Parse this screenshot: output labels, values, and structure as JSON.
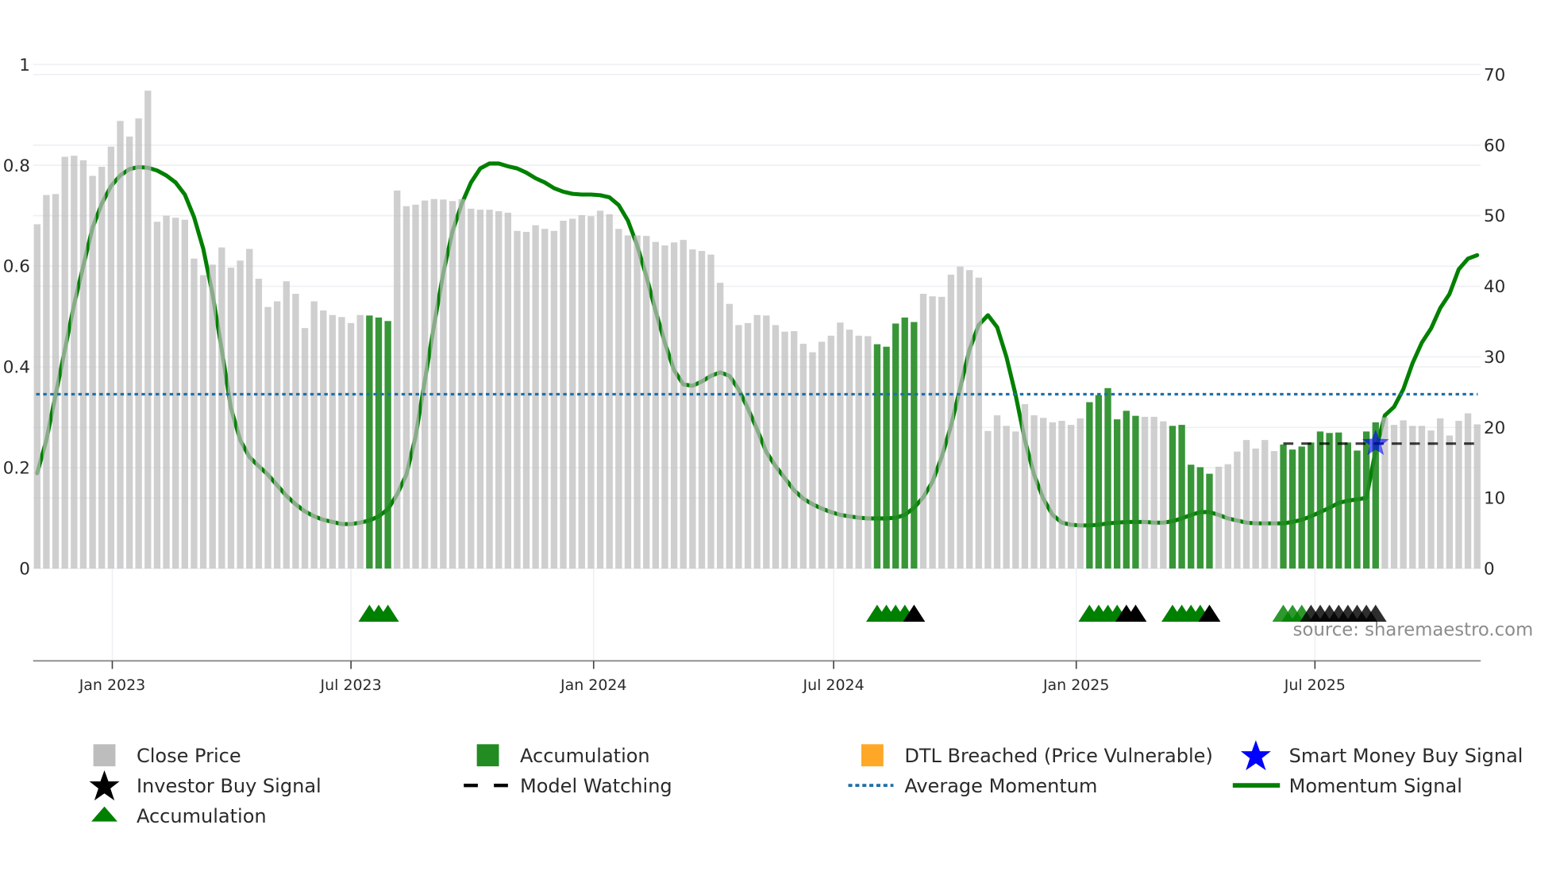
{
  "chart_data": {
    "type": "bar",
    "title": "",
    "xlabel": "",
    "ylabel": "",
    "x_start": "2022-11-05",
    "x_freq": "weekly",
    "left_axis": {
      "ylim": [
        0,
        1
      ],
      "ticks": [
        "0",
        "0.2",
        "0.4",
        "0.6",
        "0.8",
        "1"
      ],
      "tick_values": [
        0,
        0.2,
        0.4,
        0.6,
        0.8,
        1
      ]
    },
    "right_axis": {
      "ylim": [
        0,
        70
      ],
      "ticks": [
        "0",
        "10",
        "20",
        "30",
        "40",
        "50",
        "60",
        "70"
      ],
      "tick_values": [
        0,
        10,
        20,
        30,
        40,
        50,
        60,
        70
      ]
    },
    "x_ticks": [
      {
        "label": "Jan 2023",
        "date": "2023-01-01"
      },
      {
        "label": "Jul 2023",
        "date": "2023-07-01"
      },
      {
        "label": "Jan 2024",
        "date": "2024-01-01"
      },
      {
        "label": "Jul 2024",
        "date": "2024-07-01"
      },
      {
        "label": "Jan 2025",
        "date": "2025-01-01"
      },
      {
        "label": "Jul 2025",
        "date": "2025-07-01"
      }
    ],
    "grid": true,
    "close_price": [
      0.683,
      0.741,
      0.743,
      0.817,
      0.819,
      0.81,
      0.779,
      0.797,
      0.837,
      0.888,
      0.857,
      0.893,
      0.948,
      0.688,
      0.7,
      0.696,
      0.692,
      0.615,
      0.582,
      0.603,
      0.637,
      0.597,
      0.611,
      0.634,
      0.575,
      0.519,
      0.53,
      0.57,
      0.545,
      0.477,
      0.53,
      0.512,
      0.503,
      0.499,
      0.487,
      0.503,
      0.502,
      0.498,
      0.491,
      0.75,
      0.719,
      0.722,
      0.73,
      0.733,
      0.732,
      0.729,
      0.733,
      0.714,
      0.712,
      0.712,
      0.709,
      0.706,
      0.67,
      0.668,
      0.681,
      0.674,
      0.67,
      0.69,
      0.694,
      0.701,
      0.699,
      0.71,
      0.703,
      0.674,
      0.661,
      0.661,
      0.66,
      0.648,
      0.641,
      0.647,
      0.652,
      0.633,
      0.63,
      0.623,
      0.567,
      0.525,
      0.483,
      0.487,
      0.503,
      0.502,
      0.483,
      0.47,
      0.471,
      0.446,
      0.429,
      0.45,
      0.462,
      0.488,
      0.474,
      0.462,
      0.461,
      0.445,
      0.44,
      0.486,
      0.498,
      0.489,
      0.545,
      0.54,
      0.539,
      0.583,
      0.599,
      0.592,
      0.577,
      0.273,
      0.304,
      0.283,
      0.272,
      0.326,
      0.304,
      0.299,
      0.29,
      0.293,
      0.285,
      0.298,
      0.33,
      0.344,
      0.358,
      0.296,
      0.313,
      0.303,
      0.301,
      0.301,
      0.292,
      0.283,
      0.285,
      0.206,
      0.201,
      0.188,
      0.202,
      0.207,
      0.232,
      0.255,
      0.238,
      0.255,
      0.233,
      0.246,
      0.236,
      0.242,
      0.25,
      0.272,
      0.269,
      0.27,
      0.25,
      0.234,
      0.272,
      0.29,
      0.3,
      0.285,
      0.294,
      0.283,
      0.283,
      0.274,
      0.298,
      0.264,
      0.293,
      0.308,
      0.286
    ],
    "momentum_signal": [
      13.5,
      18.2,
      24.6,
      31,
      37.4,
      42.9,
      48.3,
      51.7,
      54.2,
      55.7,
      56.6,
      56.9,
      56.8,
      56.4,
      55.7,
      54.7,
      53,
      49.8,
      45.3,
      38.9,
      31,
      22.7,
      18.2,
      15.8,
      14.5,
      13.3,
      11.8,
      10.3,
      9.1,
      8.1,
      7.4,
      6.9,
      6.6,
      6.3,
      6.3,
      6.5,
      6.8,
      7.4,
      8.4,
      10.5,
      13.3,
      18.7,
      26.6,
      34.5,
      41.9,
      47.8,
      51.7,
      54.7,
      56.7,
      57.4,
      57.4,
      57,
      56.7,
      56.1,
      55.3,
      54.7,
      53.9,
      53.4,
      53.1,
      53,
      53,
      52.9,
      52.6,
      51.5,
      49.3,
      45.8,
      41.4,
      36.5,
      32,
      28.1,
      26.1,
      25.9,
      26.5,
      27.3,
      27.8,
      27.3,
      25.4,
      22.7,
      19.7,
      16.5,
      14.5,
      12.8,
      11.1,
      9.9,
      9.1,
      8.5,
      8,
      7.6,
      7.4,
      7.2,
      7.1,
      7.1,
      7.1,
      7.2,
      7.6,
      8.6,
      10.1,
      12.3,
      15.8,
      20.2,
      25.6,
      31,
      34.5,
      35.9,
      34.2,
      30,
      24.6,
      18.2,
      13.3,
      9.9,
      7.6,
      6.5,
      6.2,
      6.1,
      6.1,
      6.2,
      6.4,
      6.5,
      6.6,
      6.6,
      6.6,
      6.5,
      6.5,
      6.7,
      7.1,
      7.6,
      8.0,
      8.0,
      7.6,
      7.1,
      6.8,
      6.5,
      6.4,
      6.4,
      6.4,
      6.4,
      6.6,
      6.9,
      7.4,
      8.0,
      8.6,
      9.3,
      9.6,
      9.8,
      10.0,
      16.7,
      21.7,
      22.9,
      25.4,
      29.1,
      32,
      34,
      36.9,
      38.9,
      42.4,
      43.9,
      44.4
    ],
    "accumulation_bars": [
      36,
      37,
      38,
      91,
      92,
      93,
      94,
      95,
      114,
      115,
      116,
      117,
      118,
      119,
      123,
      124,
      125,
      126,
      127,
      135,
      136,
      137,
      138,
      139,
      140,
      141,
      142,
      143,
      144,
      145
    ],
    "triangle_markers": [
      {
        "index": 36,
        "type": "accumulation"
      },
      {
        "index": 37,
        "type": "accumulation"
      },
      {
        "index": 38,
        "type": "accumulation"
      },
      {
        "index": 91,
        "type": "accumulation"
      },
      {
        "index": 92,
        "type": "accumulation"
      },
      {
        "index": 93,
        "type": "accumulation"
      },
      {
        "index": 94,
        "type": "accumulation"
      },
      {
        "index": 95,
        "type": "investor"
      },
      {
        "index": 114,
        "type": "accumulation"
      },
      {
        "index": 115,
        "type": "accumulation"
      },
      {
        "index": 116,
        "type": "accumulation"
      },
      {
        "index": 117,
        "type": "accumulation"
      },
      {
        "index": 118,
        "type": "investor"
      },
      {
        "index": 119,
        "type": "investor"
      },
      {
        "index": 123,
        "type": "accumulation"
      },
      {
        "index": 124,
        "type": "accumulation"
      },
      {
        "index": 125,
        "type": "accumulation"
      },
      {
        "index": 126,
        "type": "accumulation"
      },
      {
        "index": 127,
        "type": "investor"
      },
      {
        "index": 135,
        "type": "accumulation"
      },
      {
        "index": 136,
        "type": "accumulation"
      },
      {
        "index": 137,
        "type": "accumulation"
      },
      {
        "index": 138,
        "type": "investor"
      },
      {
        "index": 139,
        "type": "investor"
      },
      {
        "index": 140,
        "type": "investor"
      },
      {
        "index": 141,
        "type": "investor"
      },
      {
        "index": 142,
        "type": "investor"
      },
      {
        "index": 143,
        "type": "investor"
      },
      {
        "index": 144,
        "type": "investor"
      },
      {
        "index": 145,
        "type": "investor"
      }
    ],
    "average_momentum": 24.7,
    "model_watching": {
      "from_index": 135,
      "value": 17.7
    },
    "smart_money_buy_signal": {
      "index": 145,
      "value": 17.7
    },
    "legend_placement": "bottom"
  },
  "colors": {
    "close_price": "#bdbdbd",
    "accumulation": "#228b22",
    "dtl_breached": "#ffa726",
    "smart_money": "#0000ff",
    "investor": "#000000",
    "momentum": "#008000",
    "average_momentum": "#1f6fa8",
    "triangle_accumulation": "#008000"
  },
  "legend": [
    {
      "label": "Close Price",
      "icon": "gray-square-icon"
    },
    {
      "label": "Accumulation",
      "icon": "green-square-icon"
    },
    {
      "label": "DTL Breached (Price Vulnerable)",
      "icon": "orange-square-icon"
    },
    {
      "label": "Smart Money Buy Signal",
      "icon": "blue-star-icon"
    },
    {
      "label": "Investor Buy Signal",
      "icon": "black-star-icon"
    },
    {
      "label": "Model Watching",
      "icon": "dashed-line-icon"
    },
    {
      "label": "Average Momentum",
      "icon": "dotted-line-icon"
    },
    {
      "label": "Momentum Signal",
      "icon": "solid-line-icon"
    },
    {
      "label": "Accumulation",
      "icon": "green-triangle-icon"
    }
  ],
  "source": "source: sharemaestro.com"
}
